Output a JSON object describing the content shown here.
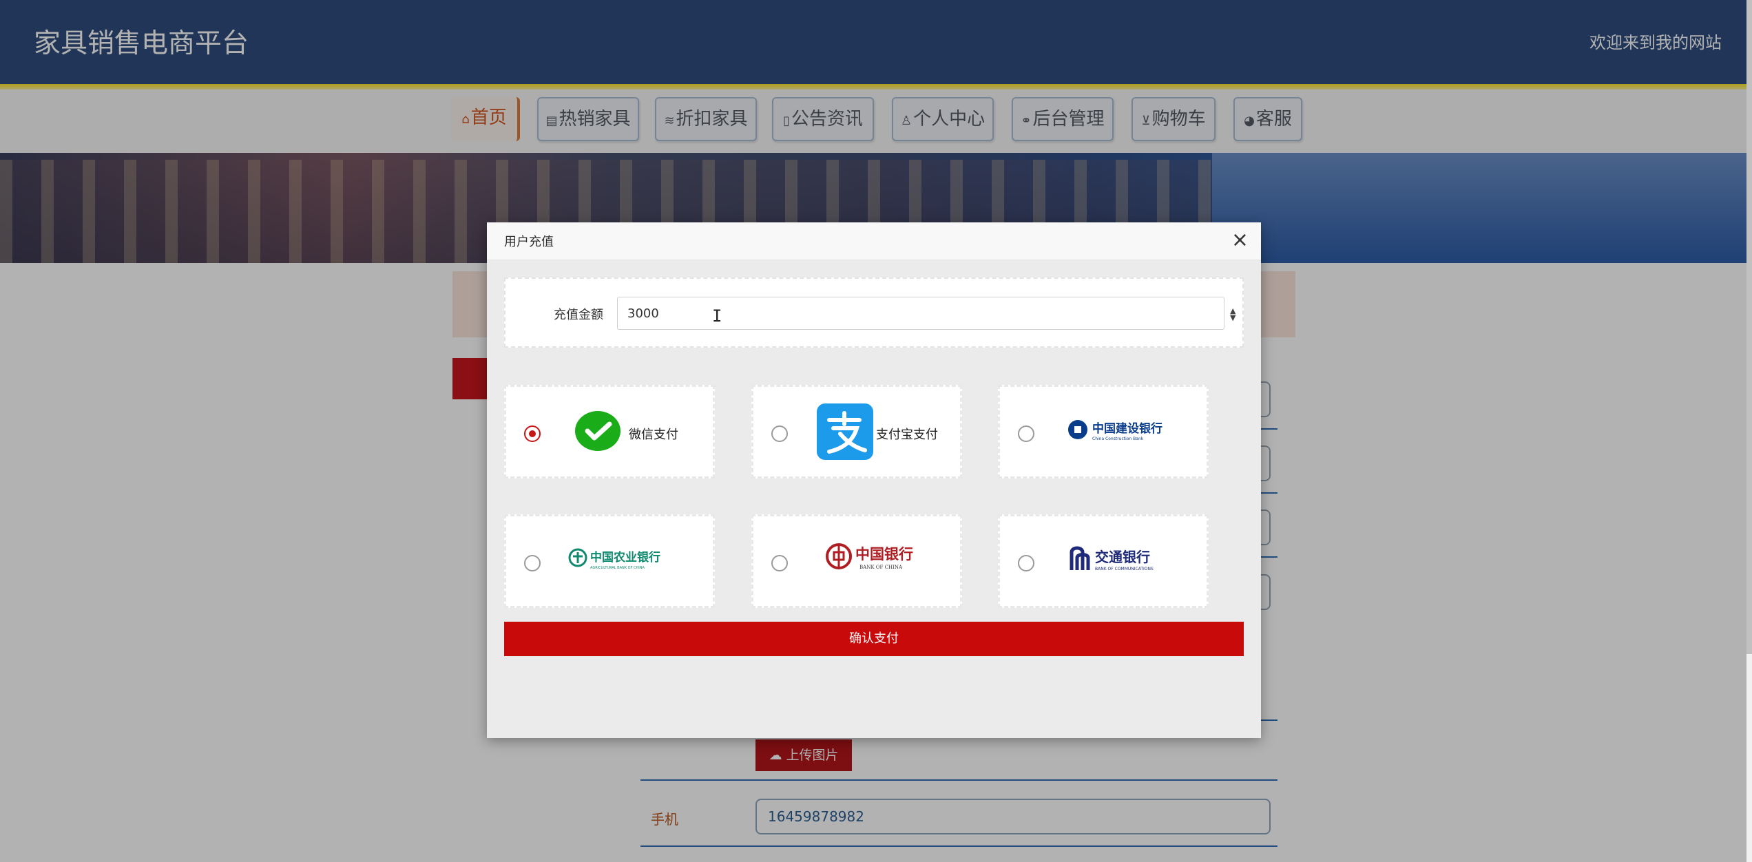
{
  "header": {
    "title": "家具销售电商平台",
    "welcome": "欢迎来到我的网站"
  },
  "nav": {
    "items": [
      {
        "icon": "home-icon",
        "glyph": "⌂",
        "label": "首页",
        "active": true
      },
      {
        "icon": "gift-icon",
        "glyph": "▤",
        "label": "热销家具"
      },
      {
        "icon": "layers-icon",
        "glyph": "≋",
        "label": "折扣家具"
      },
      {
        "icon": "note-icon",
        "glyph": "▯",
        "label": "公告资讯"
      },
      {
        "icon": "user-icon",
        "glyph": "♙",
        "label": "个人中心"
      },
      {
        "icon": "link-icon",
        "glyph": "⚭",
        "label": "后台管理"
      },
      {
        "icon": "cart-icon",
        "glyph": "⊻",
        "label": "购物车"
      },
      {
        "icon": "service-icon",
        "glyph": "◕",
        "label": "客服"
      }
    ]
  },
  "page": {
    "upload_label": "上传图片",
    "phone_label": "手机",
    "phone_value": "16459878982"
  },
  "modal": {
    "title": "用户充值",
    "close_glyph": "×",
    "amount_label": "充值金额",
    "amount_value": "3000",
    "spinner_up": "▲",
    "spinner_down": "▼",
    "methods": [
      {
        "name": "微信支付",
        "icon": "wechat-pay-icon",
        "selected": true
      },
      {
        "name": "支付宝支付",
        "icon": "alipay-icon",
        "selected": false
      },
      {
        "logo_text": "中国建设银行",
        "logo_sub": "China Construction Bank",
        "icon": "ccb-logo",
        "selected": false
      },
      {
        "logo_text": "中国农业银行",
        "logo_sub": "AGRICULTURAL BANK OF CHINA",
        "icon": "abc-logo",
        "selected": false
      },
      {
        "logo_text": "中国银行",
        "logo_sub": "BANK OF CHINA",
        "icon": "boc-logo",
        "selected": false
      },
      {
        "logo_text": "交通银行",
        "logo_sub": "BANK OF COMMUNICATIONS",
        "icon": "bocom-logo",
        "selected": false
      }
    ],
    "confirm_label": "确认支付"
  },
  "colors": {
    "header_bg": "#2e4d7d",
    "accent_red": "#c90a0a",
    "wechat_green": "#1aad19",
    "alipay_blue": "#1c9bea"
  }
}
